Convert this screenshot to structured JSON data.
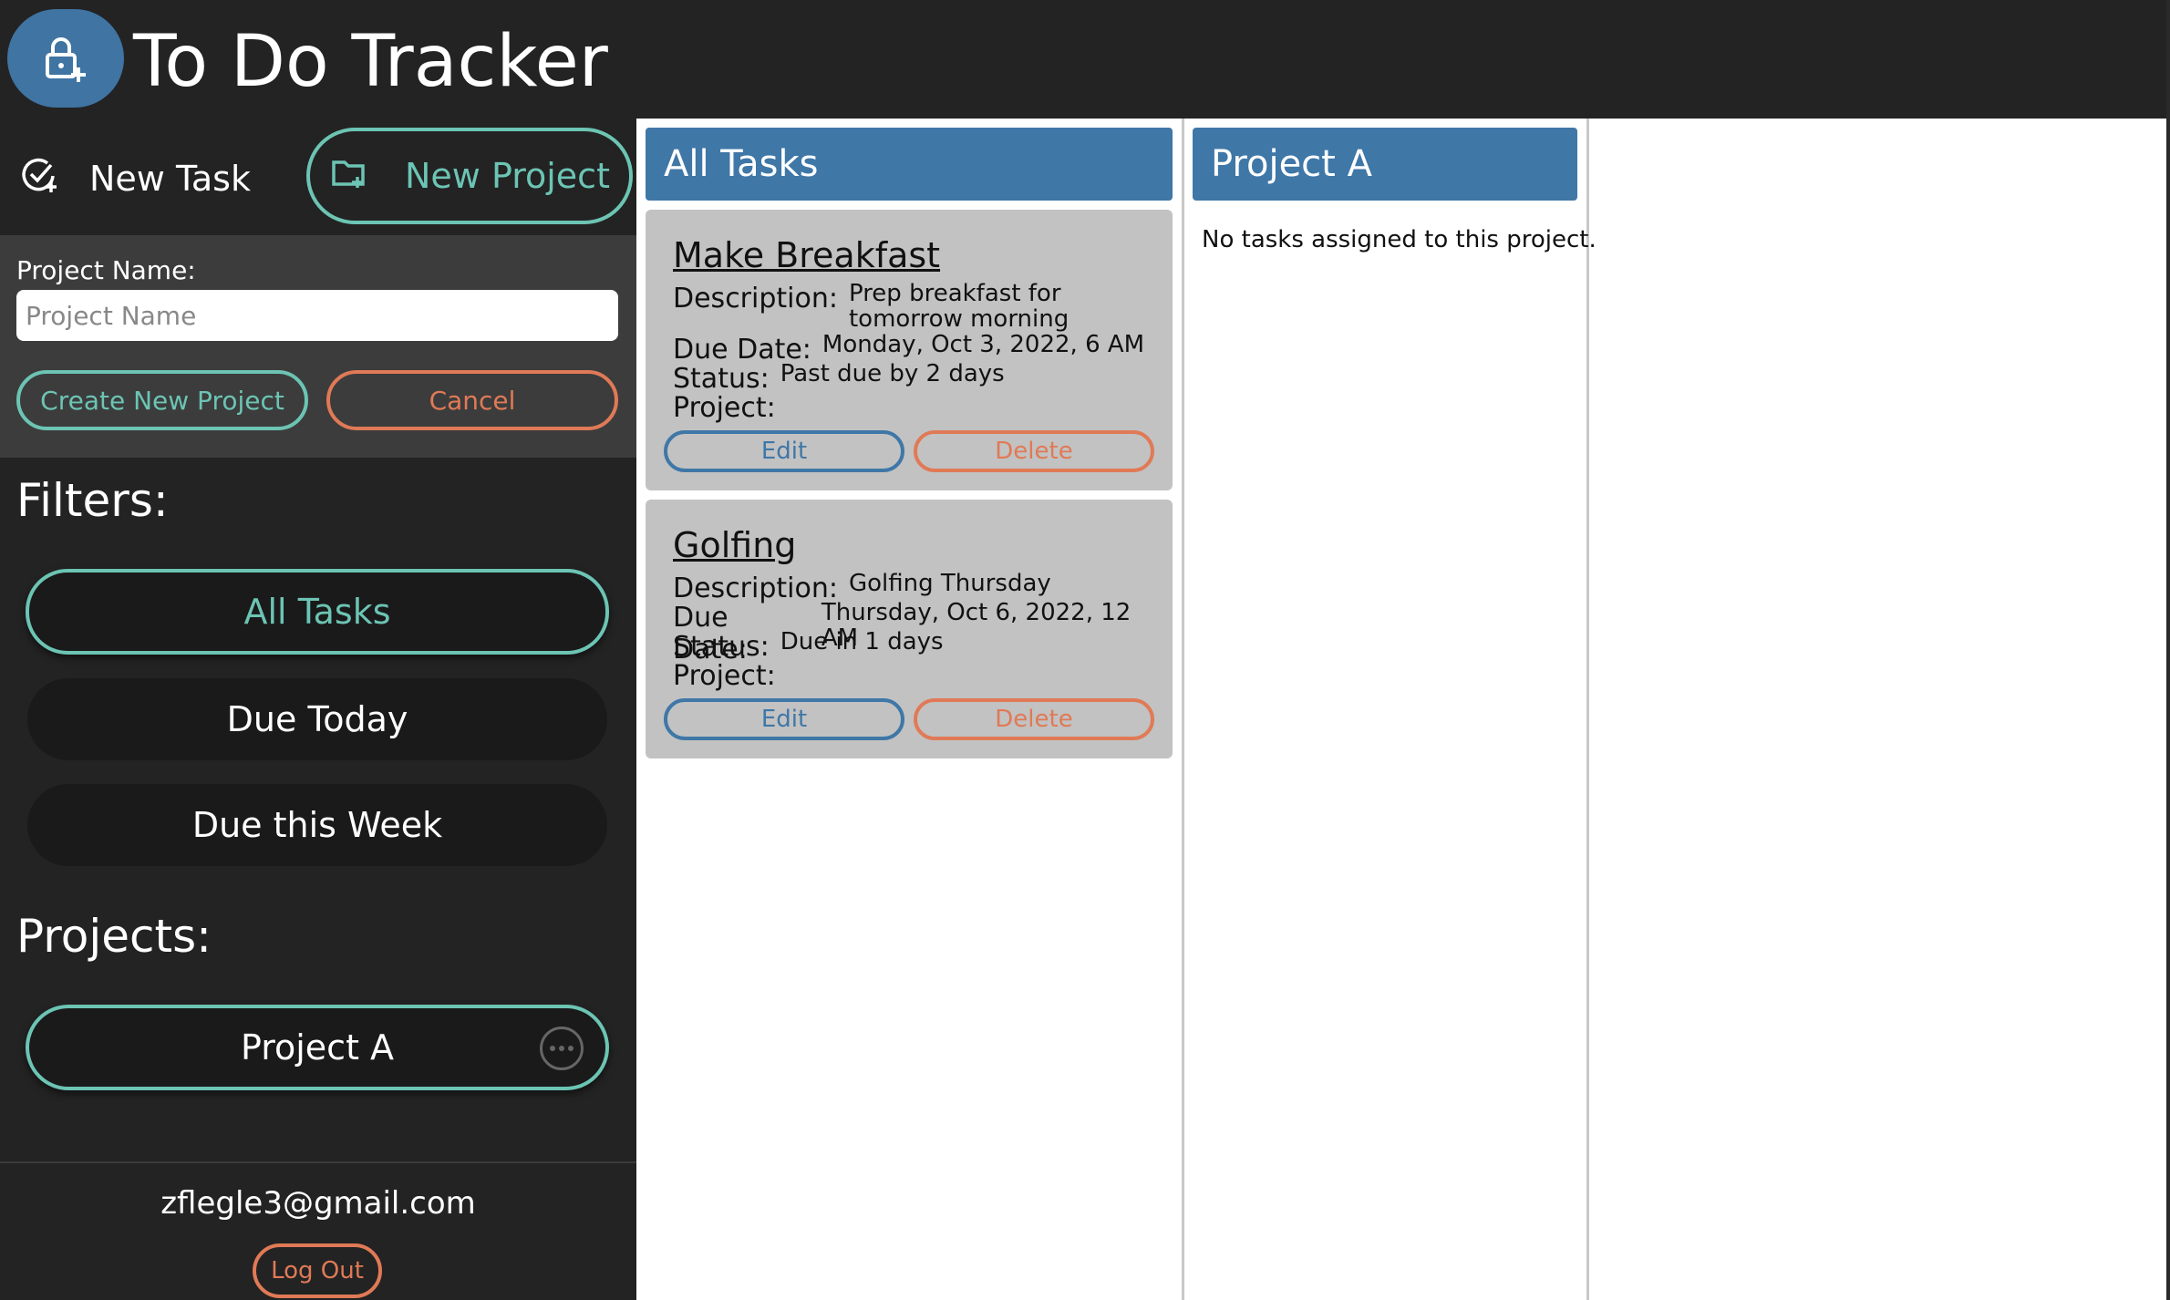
{
  "app": {
    "title": "To Do Tracker",
    "logo_icon": "lock-plus-icon"
  },
  "sidebar": {
    "new_task_label": "New Task",
    "new_project_label": "New Project",
    "project_form": {
      "label": "Project Name:",
      "placeholder": "Project Name",
      "value": "",
      "create_label": "Create New Project",
      "cancel_label": "Cancel"
    },
    "filters_heading": "Filters:",
    "filters": [
      {
        "label": "All Tasks",
        "active": true
      },
      {
        "label": "Due Today",
        "active": false
      },
      {
        "label": "Due this Week",
        "active": false
      }
    ],
    "projects_heading": "Projects:",
    "projects": [
      {
        "label": "Project A"
      }
    ],
    "user_email": "zflegle3@gmail.com",
    "logout_label": "Log Out"
  },
  "all_tasks": {
    "header": "All Tasks",
    "tasks": [
      {
        "title": "Make Breakfast",
        "description_label": "Description:",
        "description": "Prep breakfast for tomorrow morning",
        "due_label": "Due Date:",
        "due": "Monday, Oct 3, 2022, 6 AM",
        "status_label": "Status:",
        "status": "Past due by 2 days",
        "project_label": "Project:",
        "project": "",
        "edit_label": "Edit",
        "delete_label": "Delete"
      },
      {
        "title": "Golfing",
        "description_label": "Description:",
        "description": "Golfing Thursday",
        "due_label": "Due Date:",
        "due": "Thursday, Oct 6, 2022, 12 AM",
        "status_label": "Status:",
        "status": "Due in 1 days",
        "project_label": "Project:",
        "project": "",
        "edit_label": "Edit",
        "delete_label": "Delete"
      }
    ]
  },
  "project_column": {
    "header": "Project A",
    "empty_message": "No tasks assigned to this project."
  },
  "colors": {
    "accent_teal": "#6cc4b4",
    "accent_orange": "#e07a56",
    "brand_blue": "#3f77a7",
    "sidebar_bg": "#232323"
  }
}
